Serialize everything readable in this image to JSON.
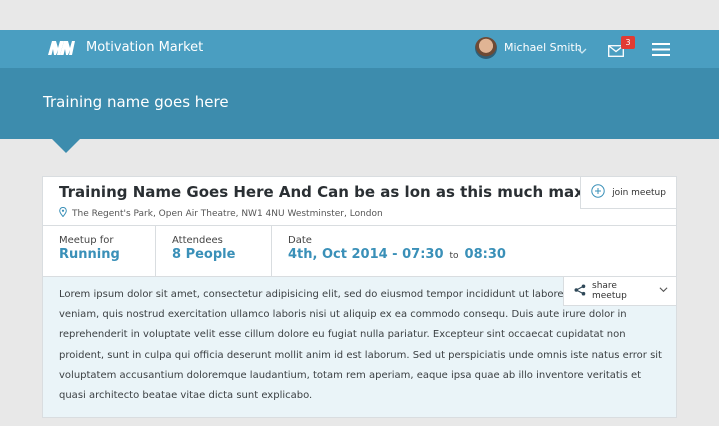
{
  "header": {
    "brand": "Motivation Market",
    "logo_icon": "mm-logo",
    "user_name": "Michael Smith",
    "notification_count": "3"
  },
  "hero": {
    "title": "Training name goes here"
  },
  "meetup": {
    "title": "Training Name Goes Here And Can be as lon as this much maximum",
    "location": "The Regent's Park, Open Air Theatre, NW1 4NU Westminster, London",
    "join_label": "join meetup",
    "share_label": "share meetup",
    "meetup_for_label": "Meetup for",
    "meetup_for_value": "Running",
    "attendees_label": "Attendees",
    "attendees_value": "8 People",
    "date_label": "Date",
    "date_start": "4th, Oct 2014 - 07:30",
    "date_to": "to",
    "date_end": "08:30",
    "description": "Lorem ipsum dolor sit amet, consectetur adipisicing elit, sed do eiusmod tempor incididunt ut labore et enim ad minim veniam, quis nostrud exercitation ullamco laboris nisi ut aliquip ex ea commodo consequ. Duis aute irure dolor in reprehenderit in voluptate velit esse cillum dolore eu fugiat nulla pariatur. Excepteur sint occaecat cupidatat non proident, sunt in culpa qui officia deserunt mollit anim id est laborum. Sed ut perspiciatis unde omnis iste natus error sit voluptatem accusantium doloremque laudantium, totam rem aperiam, eaque ipsa quae ab illo inventore veritatis et quasi architecto beatae vitae dicta sunt explicabo."
  },
  "colors": {
    "topbar": "#4a9ec1",
    "hero": "#3d8cad",
    "accent": "#3a90b8",
    "badge": "#e23b33",
    "description_bg": "#eaf4f8"
  }
}
